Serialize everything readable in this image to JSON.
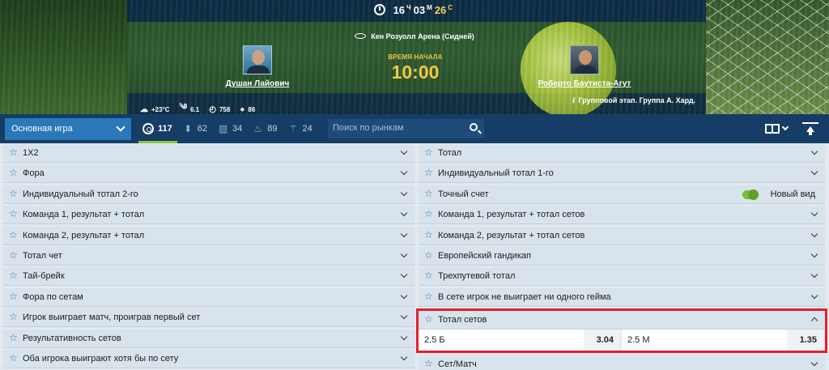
{
  "timer": {
    "hours": "16",
    "hours_unit": "Ч",
    "minutes": "03",
    "minutes_unit": "М",
    "seconds": "26",
    "seconds_unit": "С"
  },
  "venue": "Кен Розуолл Арена (Сидней)",
  "start": {
    "label": "ВРЕМЯ НАЧАЛА",
    "time": "10:00"
  },
  "players": [
    {
      "name": "Душан Лайович"
    },
    {
      "name": "Роберто Баутиста-Агут"
    }
  ],
  "weather": {
    "temperature": "+23°C",
    "wind": "6.1",
    "pressure": "758",
    "humidity": "86"
  },
  "stage": "Групповой этап. Группа А. Хард.",
  "toolbar": {
    "dropdown_label": "Основная игра",
    "stats": [
      {
        "icon": "target-icon",
        "value": "117"
      },
      {
        "icon": "updown-icon",
        "value": "62"
      },
      {
        "icon": "bars-icon",
        "value": "34"
      },
      {
        "icon": "fire-icon",
        "value": "89"
      },
      {
        "icon": "wand-icon",
        "value": "24"
      }
    ],
    "search_placeholder": "Поиск по рынкам"
  },
  "markets_left": [
    "1X2",
    "Фора",
    "Индивидуальный тотал 2-го",
    "Команда 1, результат + тотал",
    "Команда 2, результат + тотал",
    "Тотал чет",
    "Тай-брейк",
    "Фора по сетам",
    "Игрок выиграет матч, проиграв первый сет",
    "Результативность сетов",
    "Оба игрока выиграют хотя бы по сету"
  ],
  "markets_right": [
    "Тотал",
    "Индивидуальный тотал 1-го",
    "Точный счет",
    "Команда 1, результат + тотал сетов",
    "Команда 2, результат + тотал сетов",
    "Европейский гандикап",
    "Трехпутевой тотал",
    "В сете игрок не выиграет ни одного гейма"
  ],
  "new_view_label": "Новый вид",
  "expanded_market": {
    "title": "Тотал сетов",
    "outcomes": [
      {
        "label": "2.5 Б",
        "odd": "3.04"
      },
      {
        "label": "2.5 М",
        "odd": "1.35"
      }
    ]
  },
  "last_right_market": "Сет/Матч",
  "colors": {
    "highlight": "#e0212f",
    "accent": "#8ac63f",
    "toolbar": "#163d66"
  }
}
